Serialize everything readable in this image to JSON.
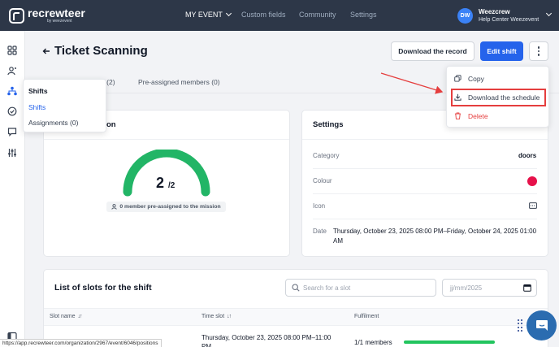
{
  "app": {
    "logo_name": "recrewteer",
    "logo_sub": "by weezevent"
  },
  "topnav": {
    "items": [
      {
        "label": "MY EVENT",
        "active": true
      },
      {
        "label": "Custom fields"
      },
      {
        "label": "Community"
      },
      {
        "label": "Settings"
      }
    ],
    "user": {
      "initials": "DW",
      "name": "Weezcrew",
      "subtitle": "Help Center Weezevent"
    }
  },
  "sidebar": {
    "icons": [
      "grid-icon",
      "user-group-icon",
      "hierarchy-icon",
      "check-circle-icon",
      "chat-icon",
      "sliders-icon",
      "panel-icon"
    ]
  },
  "flyout": {
    "title": "Shifts",
    "items": [
      {
        "label": "Shifts",
        "active": true
      },
      {
        "label": "Assignments (0)"
      }
    ]
  },
  "header": {
    "title": "Ticket Scanning",
    "download_record_label": "Download the record",
    "edit_shift_label": "Edit shift"
  },
  "tabs": {
    "partial_members": "ers (2)",
    "preassigned": "Pre-assigned members (0)"
  },
  "dropdown": {
    "items": [
      {
        "label": "Copy",
        "icon": "copy-icon"
      },
      {
        "label": "Download the schedule",
        "icon": "download-icon",
        "highlighted": true
      },
      {
        "label": "Delete",
        "icon": "trash-icon",
        "danger": true
      }
    ]
  },
  "mission_card": {
    "title_partial": "on",
    "count": "2",
    "total": "/2",
    "fill_fraction": 1.0,
    "badge": "0 member pre-assigned to the mission"
  },
  "settings_card": {
    "title": "Settings",
    "rows": [
      {
        "label": "Category",
        "value": "doors"
      },
      {
        "label": "Colour",
        "value_color": "#e6114a"
      },
      {
        "label": "Icon",
        "value_icon": "ticket-icon"
      },
      {
        "label": "Date",
        "value": "Thursday, October 23, 2025 08:00 PM–Friday, October 24, 2025 01:00 AM"
      }
    ]
  },
  "slots_card": {
    "title": "List of slots for the shift",
    "search_placeholder": "Search for a slot",
    "date_placeholder": "jj/mm/2025",
    "columns": [
      "Slot name",
      "Time slot",
      "Fulfilment"
    ],
    "rows": [
      {
        "time_slot": "Thursday, October 23, 2025 08:00 PM–11:00 PM",
        "fulfilment": "1/1 members",
        "fill_fraction": 1.0
      }
    ]
  },
  "status_url": "https://app.recrewteer.com/organization/2967/event/6046/positions",
  "colors": {
    "nav_bg": "#2d3748",
    "primary": "#2563eb",
    "success": "#22c55e",
    "danger": "#e53e3e"
  }
}
